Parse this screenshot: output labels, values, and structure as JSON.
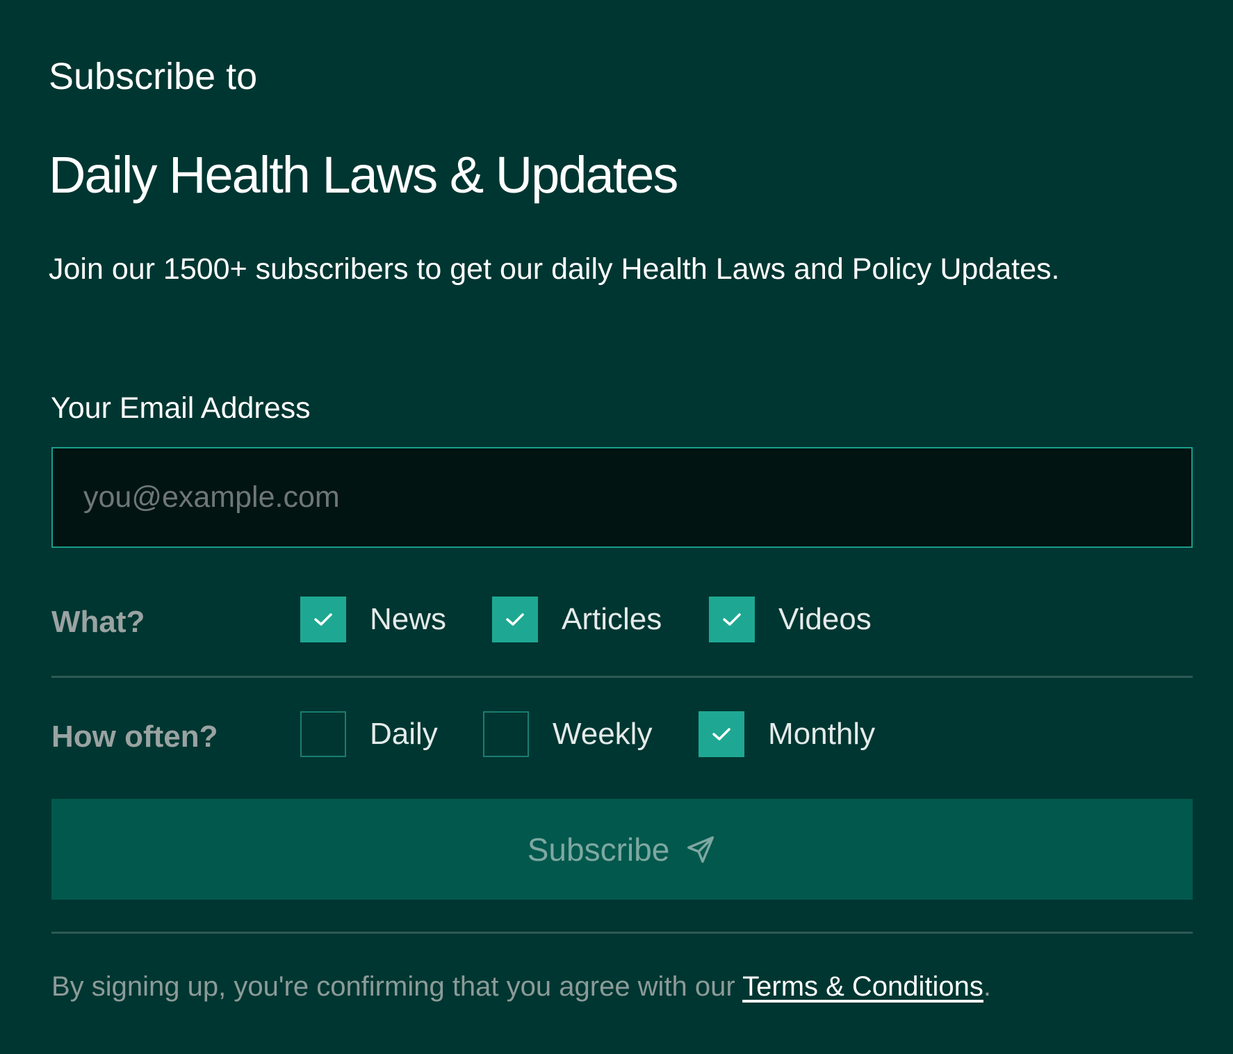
{
  "header": {
    "kicker": "Subscribe to",
    "title": "Daily Health Laws & Updates",
    "description": "Join our 1500+ subscribers to get our daily Health Laws and Policy Updates."
  },
  "email": {
    "label": "Your Email Address",
    "placeholder": "you@example.com",
    "value": ""
  },
  "what": {
    "label": "What?",
    "options": [
      {
        "label": "News",
        "checked": true
      },
      {
        "label": "Articles",
        "checked": true
      },
      {
        "label": "Videos",
        "checked": true
      }
    ]
  },
  "frequency": {
    "label": "How often?",
    "options": [
      {
        "label": "Daily",
        "checked": false
      },
      {
        "label": "Weekly",
        "checked": false
      },
      {
        "label": "Monthly",
        "checked": true
      }
    ]
  },
  "subscribe_button": {
    "label": "Subscribe",
    "icon": "send-icon"
  },
  "footer": {
    "prefix": "By signing up, you're confirming that you agree with our ",
    "link_text": "Terms & Conditions",
    "suffix": "."
  },
  "colors": {
    "background": "#003631",
    "accent": "#1ea893",
    "input_bg": "#011412",
    "button_bg": "#03584d"
  }
}
